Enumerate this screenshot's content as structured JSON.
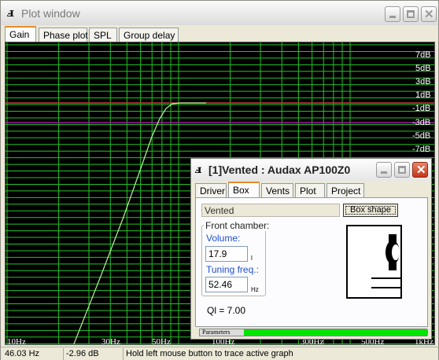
{
  "window": {
    "title": "Plot window",
    "tabs": [
      {
        "label": "Gain",
        "active": true
      },
      {
        "label": "Phase plot",
        "active": false
      },
      {
        "label": "SPL",
        "active": false
      },
      {
        "label": "Group delay",
        "active": false
      }
    ]
  },
  "plot": {
    "background": "#000000",
    "grid_color": "#25c425",
    "reference_line_color": "#c83a3a",
    "minus3db_line_color": "#a01aa6",
    "curve_color": "#b4f59b",
    "db_labels": [
      "7dB",
      "5dB",
      "3dB",
      "1dB",
      "-1dB",
      "-3dB",
      "-5dB",
      "-7dB"
    ],
    "freq_labels": [
      "10Hz",
      "30Hz",
      "50Hz",
      "100Hz",
      "300Hz",
      "500Hz",
      "1kHz"
    ]
  },
  "status": {
    "frequency": "46.03 Hz",
    "level": "-2.96 dB",
    "hint": "Hold left mouse button to trace active graph"
  },
  "dialog": {
    "title": "[1]Vented : Audax AP100Z0",
    "tabs": [
      {
        "label": "Driver",
        "active": false
      },
      {
        "label": "Box",
        "active": true
      },
      {
        "label": "Vents",
        "active": false
      },
      {
        "label": "Plot",
        "active": false
      },
      {
        "label": "Project",
        "active": false
      }
    ],
    "box_type": "Vented",
    "box_shape_button": "Box shape",
    "front_chamber_label": "Front chamber:",
    "volume_label": "Volume:",
    "volume_value": "17.9",
    "volume_unit": "l",
    "tuning_label": "Tuning freq.:",
    "tuning_value": "52.46",
    "tuning_unit": "Hz",
    "ql": "Ql = 7.00",
    "parameters_label": "Parameters",
    "progress_fraction": 0.8
  }
}
